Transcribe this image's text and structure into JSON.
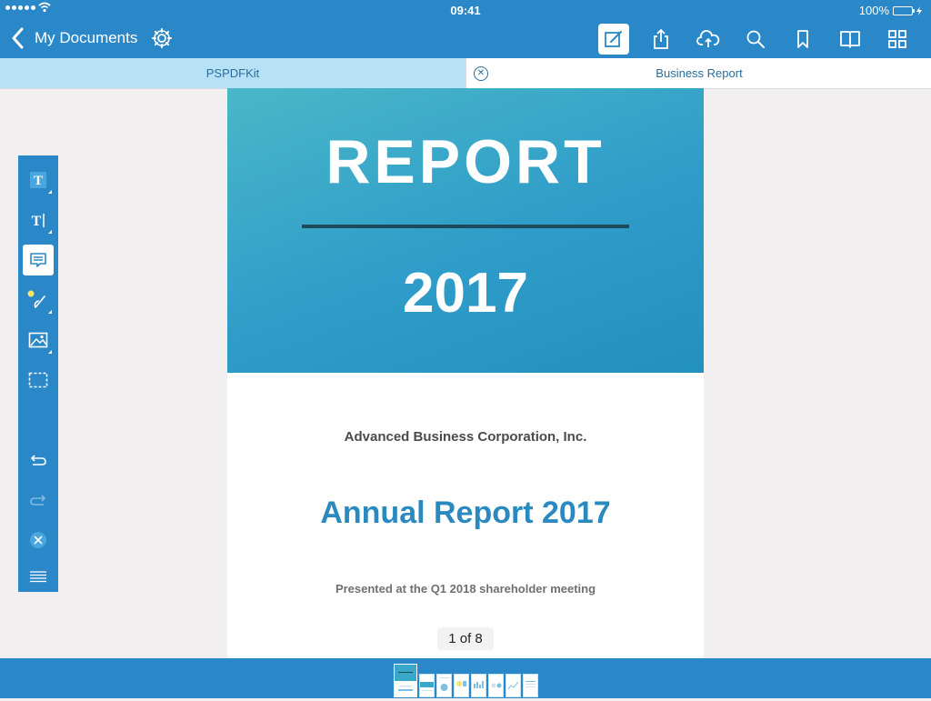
{
  "status": {
    "time": "09:41",
    "battery": "100%"
  },
  "nav": {
    "back_label": "My Documents"
  },
  "tabs": [
    {
      "label": "PSPDFKit"
    },
    {
      "label": "Business Report"
    }
  ],
  "page": {
    "hero_title": "REPORT",
    "hero_year": "2017",
    "company": "Advanced Business Corporation, Inc.",
    "annual_title": "Annual Report 2017",
    "presented": "Presented at the Q1 2018 shareholder meeting",
    "page_indicator": "1 of 8"
  },
  "colors": {
    "accent": "#2a88c8",
    "tab_active": "#b7e2f6",
    "title_blue": "#2a8ac0"
  },
  "icons": {
    "top_toolbar": [
      "edit-icon",
      "share-icon",
      "cloud-upload-icon",
      "search-icon",
      "bookmark-icon",
      "book-icon",
      "grid-icon"
    ],
    "annotation_toolbar": [
      "text-annotation-icon",
      "free-text-icon",
      "note-icon",
      "ink-icon",
      "image-icon",
      "selection-icon",
      "undo-icon",
      "redo-icon",
      "close-icon",
      "menu-icon"
    ]
  }
}
